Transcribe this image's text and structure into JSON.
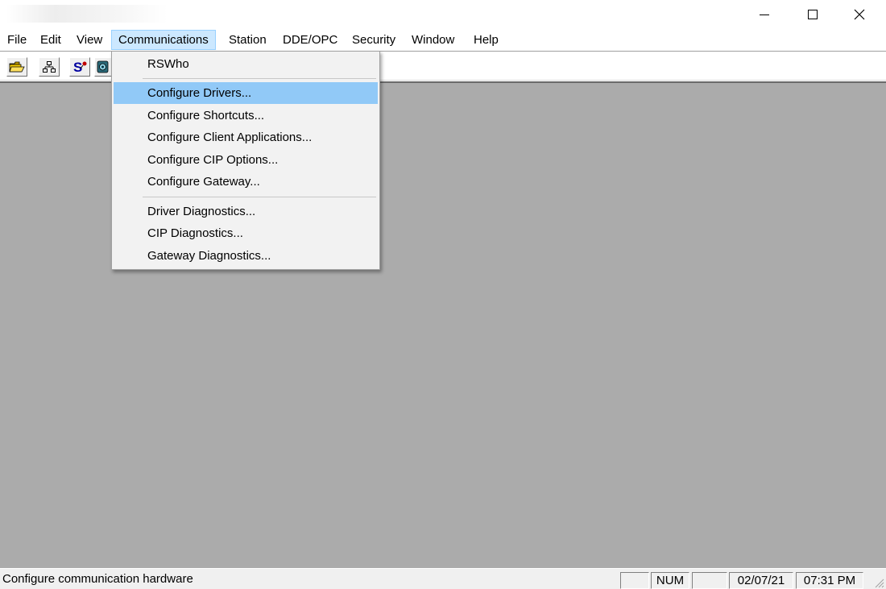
{
  "window": {
    "title": "",
    "minimize_label": "minimize",
    "maximize_label": "maximize",
    "close_label": "close"
  },
  "menubar": {
    "items": [
      {
        "label": "File"
      },
      {
        "label": "Edit"
      },
      {
        "label": "View"
      },
      {
        "label": "Communications"
      },
      {
        "label": "Station"
      },
      {
        "label": "DDE/OPC"
      },
      {
        "label": "Security"
      },
      {
        "label": "Window"
      },
      {
        "label": "Help"
      }
    ],
    "active": "Communications"
  },
  "toolbar": {
    "buttons": [
      {
        "icon": "open-folder-icon"
      },
      {
        "icon": "network-tree-icon"
      },
      {
        "icon": "driver-config-icon"
      },
      {
        "icon": "diagnostics-icon"
      }
    ]
  },
  "communications_menu": {
    "items": [
      {
        "label": "RSWho"
      },
      {
        "label": "Configure Drivers..."
      },
      {
        "label": "Configure Shortcuts..."
      },
      {
        "label": "Configure Client Applications..."
      },
      {
        "label": "Configure CIP Options..."
      },
      {
        "label": "Configure Gateway..."
      },
      {
        "label": "Driver Diagnostics..."
      },
      {
        "label": "CIP Diagnostics..."
      },
      {
        "label": "Gateway Diagnostics..."
      }
    ],
    "highlighted": "Configure Drivers..."
  },
  "statusbar": {
    "message": "Configure communication hardware",
    "panel_caps": "",
    "panel_num": "NUM",
    "panel_scrl": "",
    "date": "02/07/21",
    "time": "07:31 PM"
  },
  "colors": {
    "workspace": "#ababab",
    "menu_highlight": "#91c9f7",
    "menubar_active": "#cce8ff"
  }
}
